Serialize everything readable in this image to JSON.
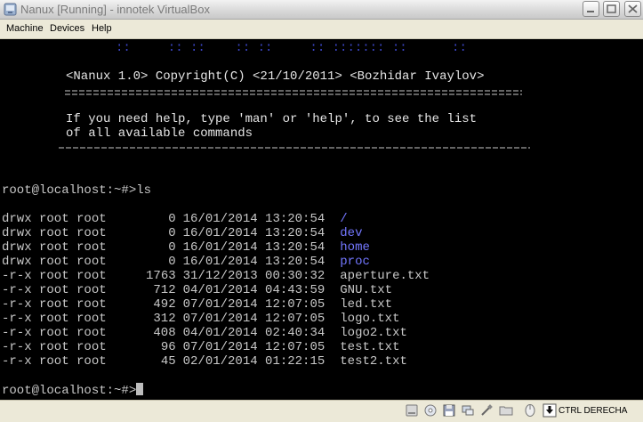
{
  "window": {
    "title": "Nanux [Running] - innotek VirtualBox"
  },
  "menu": [
    "Machine",
    "Devices",
    "Help"
  ],
  "console": {
    "dots_row": "::     :: ::    :: ::     :: ::::::: ::      ::",
    "banner_line": "<Nanux 1.0> Copyright(C) <21/10/2011> <Bozhidar Ivaylov>",
    "help_line1": "If you need help, type 'man' or 'help', to see the list",
    "help_line2": "of all available commands",
    "prompt_ls": "root@localhost:~#>ls",
    "listing": [
      {
        "perms": "drwx root root",
        "size": "0",
        "date": "16/01/2014 13:20:54",
        "name": "/",
        "dir": true
      },
      {
        "perms": "drwx root root",
        "size": "0",
        "date": "16/01/2014 13:20:54",
        "name": "dev",
        "dir": true
      },
      {
        "perms": "drwx root root",
        "size": "0",
        "date": "16/01/2014 13:20:54",
        "name": "home",
        "dir": true
      },
      {
        "perms": "drwx root root",
        "size": "0",
        "date": "16/01/2014 13:20:54",
        "name": "proc",
        "dir": true
      },
      {
        "perms": "-r-x root root",
        "size": "1763",
        "date": "31/12/2013 00:30:32",
        "name": "aperture.txt",
        "dir": false
      },
      {
        "perms": "-r-x root root",
        "size": "712",
        "date": "04/01/2014 04:43:59",
        "name": "GNU.txt",
        "dir": false
      },
      {
        "perms": "-r-x root root",
        "size": "492",
        "date": "07/01/2014 12:07:05",
        "name": "led.txt",
        "dir": false
      },
      {
        "perms": "-r-x root root",
        "size": "312",
        "date": "07/01/2014 12:07:05",
        "name": "logo.txt",
        "dir": false
      },
      {
        "perms": "-r-x root root",
        "size": "408",
        "date": "04/01/2014 02:40:34",
        "name": "logo2.txt",
        "dir": false
      },
      {
        "perms": "-r-x root root",
        "size": "96",
        "date": "07/01/2014 12:07:05",
        "name": "test.txt",
        "dir": false
      },
      {
        "perms": "-r-x root root",
        "size": "45",
        "date": "02/01/2014 01:22:15",
        "name": "test2.txt",
        "dir": false
      }
    ],
    "prompt_final": "root@localhost:~#>"
  },
  "status": {
    "host_key": "CTRL DERECHA",
    "icons": [
      "hard-disk-icon",
      "cd-icon",
      "floppy-icon",
      "network-icon",
      "usb-icon",
      "shared-folders-icon",
      "mouse-integration-icon",
      "host-key-icon"
    ]
  },
  "colors": {
    "console_bg": "#000000",
    "console_text": "#c8c8c8",
    "directory": "#7377ff",
    "dots": "#3c46c8"
  }
}
